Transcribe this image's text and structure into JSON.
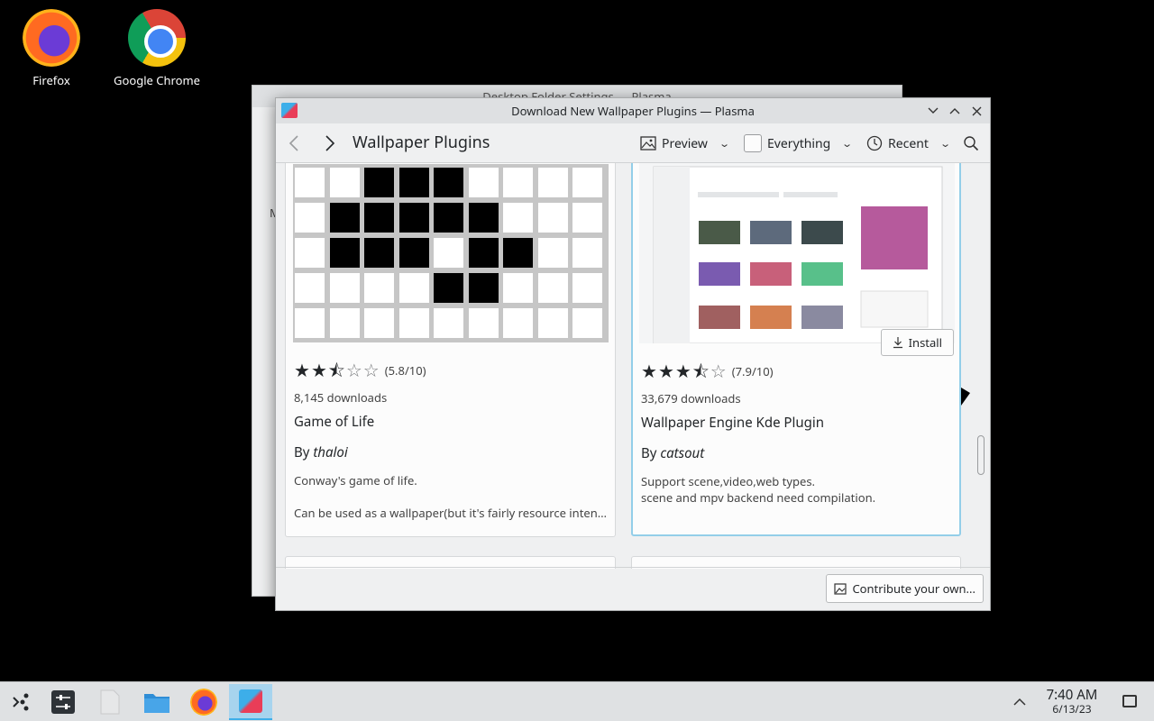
{
  "desktop": {
    "icons": [
      {
        "label": "Firefox"
      },
      {
        "label": "Google Chrome"
      }
    ]
  },
  "back_window": {
    "title": "Desktop Folder Settings — Plasma",
    "side_letter": "M"
  },
  "window": {
    "title": "Download New Wallpaper Plugins — Plasma",
    "heading": "Wallpaper Plugins",
    "view_mode": "Preview",
    "filter": "Everything",
    "sort": "Recent"
  },
  "cards": [
    {
      "rating_text": "(5.8/10)",
      "rating_value": 5.8,
      "downloads": "8,145 downloads",
      "name": "Game of Life",
      "by_prefix": "By",
      "author": "thaloi",
      "desc_line1": "Conway's game of life.",
      "desc_line2": "Can be used as a wallpaper(but it's fairly resource intensive)"
    },
    {
      "rating_text": "(7.9/10)",
      "rating_value": 7.9,
      "downloads": "33,679 downloads",
      "name": "Wallpaper Engine Kde Plugin",
      "by_prefix": "By",
      "author": "catsout",
      "desc_line1": "Support scene,video,web types.",
      "desc_line2": "scene and mpv backend need compilation.",
      "install_label": "Install"
    }
  ],
  "footer": {
    "contribute_label": "Contribute your own..."
  },
  "taskbar": {
    "time": "7:40 AM",
    "date": "6/13/23"
  },
  "colors": {
    "accent": "#3daee9",
    "selection_border": "#93cee9",
    "taskbar_bg": "#dfe1e3"
  }
}
